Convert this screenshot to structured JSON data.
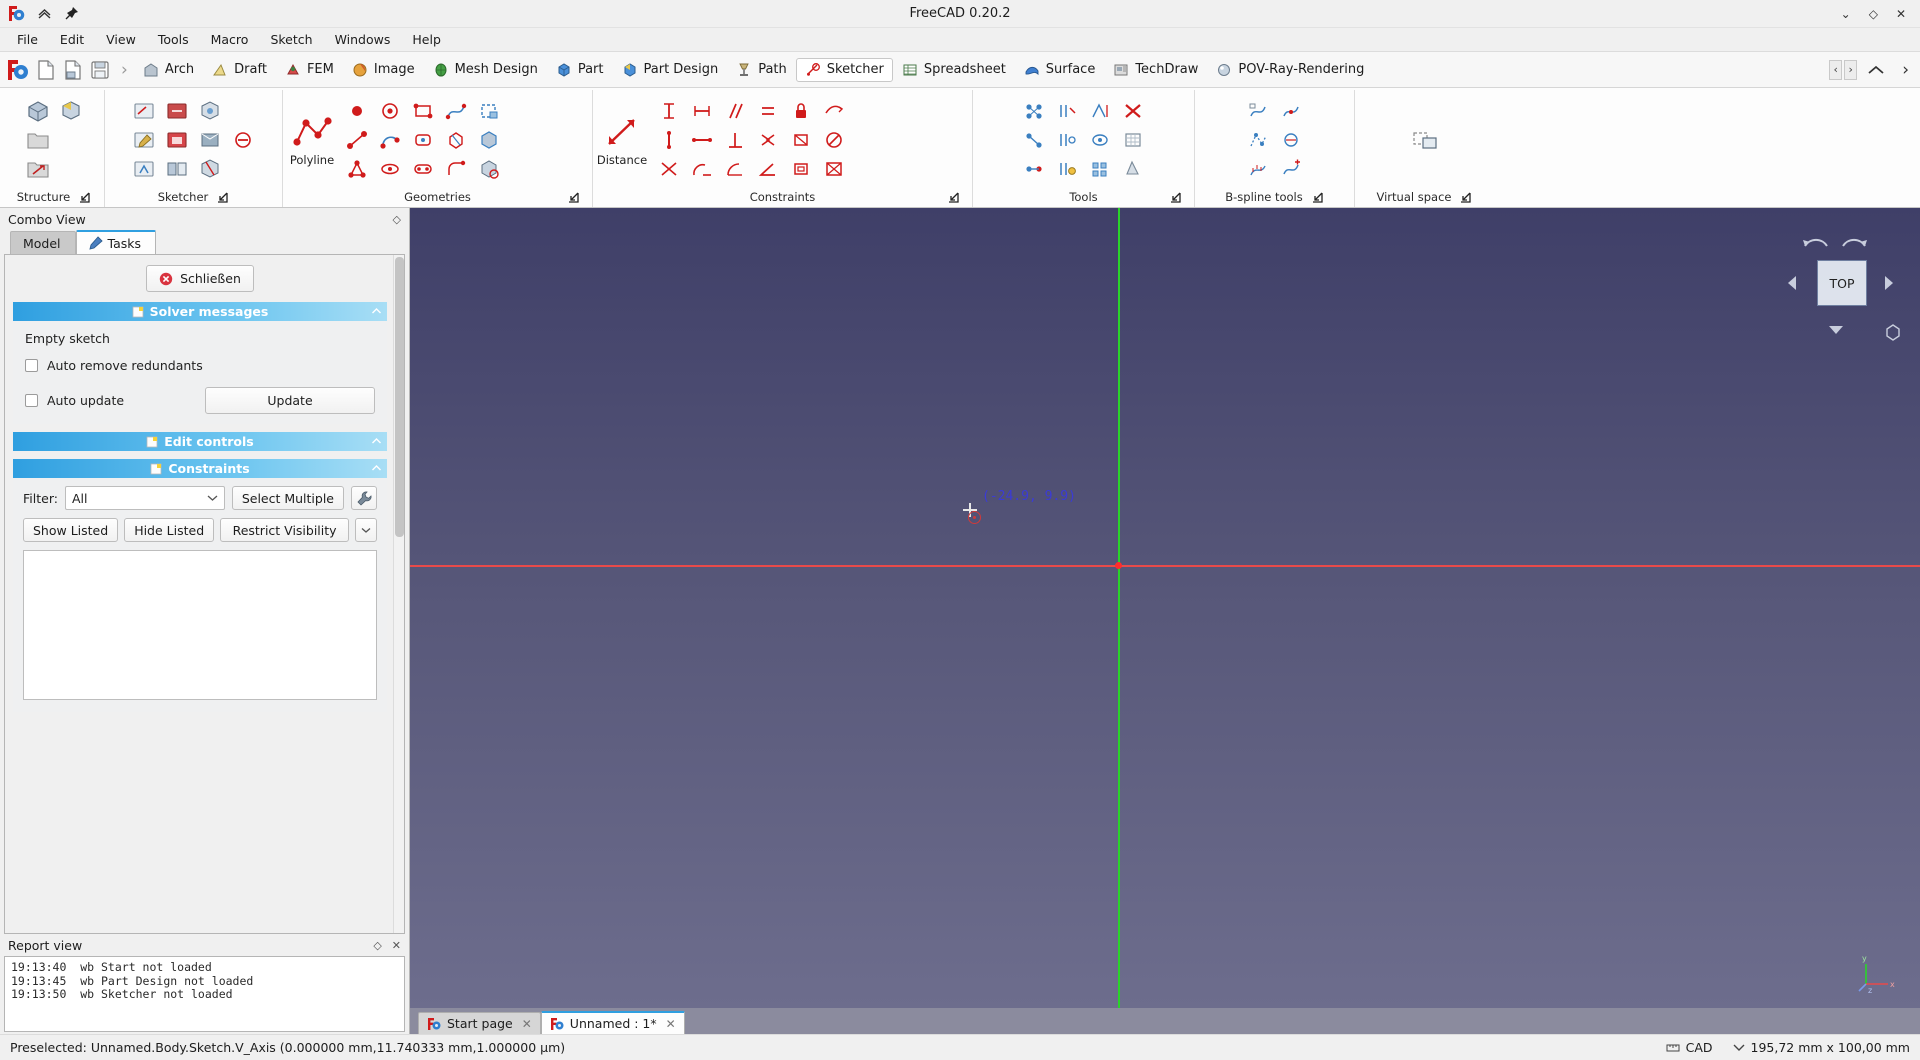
{
  "window": {
    "title": "FreeCAD 0.20.2",
    "minimize": "⌄",
    "maximize": "◇",
    "close": "✕"
  },
  "menubar": {
    "items": [
      "File",
      "Edit",
      "View",
      "Tools",
      "Macro",
      "Sketch",
      "Windows",
      "Help"
    ]
  },
  "workbench_bar": {
    "tabs": [
      {
        "label": "Arch",
        "icon": "arch-icon",
        "active": false
      },
      {
        "label": "Draft",
        "icon": "draft-icon",
        "active": false
      },
      {
        "label": "FEM",
        "icon": "fem-icon",
        "active": false
      },
      {
        "label": "Image",
        "icon": "image-icon",
        "active": false
      },
      {
        "label": "Mesh Design",
        "icon": "mesh-design-icon",
        "active": false
      },
      {
        "label": "Part",
        "icon": "part-icon",
        "active": false
      },
      {
        "label": "Part Design",
        "icon": "part-design-icon",
        "active": false
      },
      {
        "label": "Path",
        "icon": "path-icon",
        "active": false
      },
      {
        "label": "Sketcher",
        "icon": "sketcher-icon",
        "active": true
      },
      {
        "label": "Spreadsheet",
        "icon": "spreadsheet-icon",
        "active": false
      },
      {
        "label": "Surface",
        "icon": "surface-icon",
        "active": false
      },
      {
        "label": "TechDraw",
        "icon": "techdraw-icon",
        "active": false
      },
      {
        "label": "POV-Ray-Rendering",
        "icon": "povray-icon",
        "active": false
      }
    ],
    "separator": "›",
    "nav_prev": "‹",
    "nav_next": "›",
    "collapse": "⌃",
    "expand": "›"
  },
  "ribbon": {
    "groups": [
      {
        "label": "Structure",
        "dialog_arrow": "↘"
      },
      {
        "label": "Sketcher",
        "dialog_arrow": "↘"
      },
      {
        "label": "Geometries",
        "dialog_arrow": "↘",
        "big_label": "Polyline"
      },
      {
        "label": "Constraints",
        "dialog_arrow": "↘",
        "big_label": "Distance"
      },
      {
        "label": "Tools",
        "dialog_arrow": "↘"
      },
      {
        "label": "B-spline tools",
        "dialog_arrow": "↘"
      },
      {
        "label": "Virtual space",
        "dialog_arrow": "↘"
      }
    ]
  },
  "combo_view": {
    "title": "Combo View",
    "float_icon": "◇",
    "tabs": [
      {
        "label": "Model",
        "active": false
      },
      {
        "label": "Tasks",
        "active": true,
        "icon": "pencil-icon"
      }
    ],
    "close_button": "Schließen",
    "solver": {
      "header": "Solver messages",
      "message": "Empty sketch",
      "auto_remove_redundants": "Auto remove redundants",
      "auto_remove_redundants_checked": false,
      "auto_update": "Auto update",
      "auto_update_checked": false,
      "update_button": "Update",
      "collapse_icon": "⌃"
    },
    "edit_controls": {
      "header": "Edit controls",
      "collapse_icon": "⌃"
    },
    "constraints": {
      "header": "Constraints",
      "collapse_icon": "⌃",
      "filter_label": "Filter:",
      "filter_value": "All",
      "select_multiple": "Select Multiple",
      "settings_icon": "wrench-icon",
      "show_listed": "Show Listed",
      "hide_listed": "Hide Listed",
      "restrict_visibility": "Restrict Visibility",
      "dropdown_icon": "chevron-down-icon",
      "list_items": []
    }
  },
  "report_view": {
    "title": "Report view",
    "float_icon": "◇",
    "close_icon": "✕",
    "lines": [
      "19:13:40  wb Start not loaded",
      "19:13:45  wb Part Design not loaded",
      "19:13:50  wb Sketcher not loaded"
    ]
  },
  "viewport": {
    "cursor_coordinates": "(-24.9, 9.9)",
    "navcube_face": "TOP",
    "axis_labels": {
      "x": "x",
      "y": "y",
      "z": "z"
    },
    "colors": {
      "x_axis": "#e84a4a",
      "y_axis": "#2ad42a",
      "origin": "#ff2d2d",
      "coord_text": "#3b3bd6"
    }
  },
  "doc_tabs": [
    {
      "label": "Start page",
      "active": false,
      "close": "✕"
    },
    {
      "label": "Unnamed : 1*",
      "active": true,
      "close": "✕"
    }
  ],
  "statusbar": {
    "message": "Preselected: Unnamed.Body.Sketch.V_Axis (0.000000 mm,11.740333 mm,1.000000 µm)",
    "unit_system": "CAD",
    "unit_icon": "ruler-icon",
    "dimension_icon": "chevron-down-icon",
    "dimensions": "195,72 mm x 100,00 mm"
  }
}
